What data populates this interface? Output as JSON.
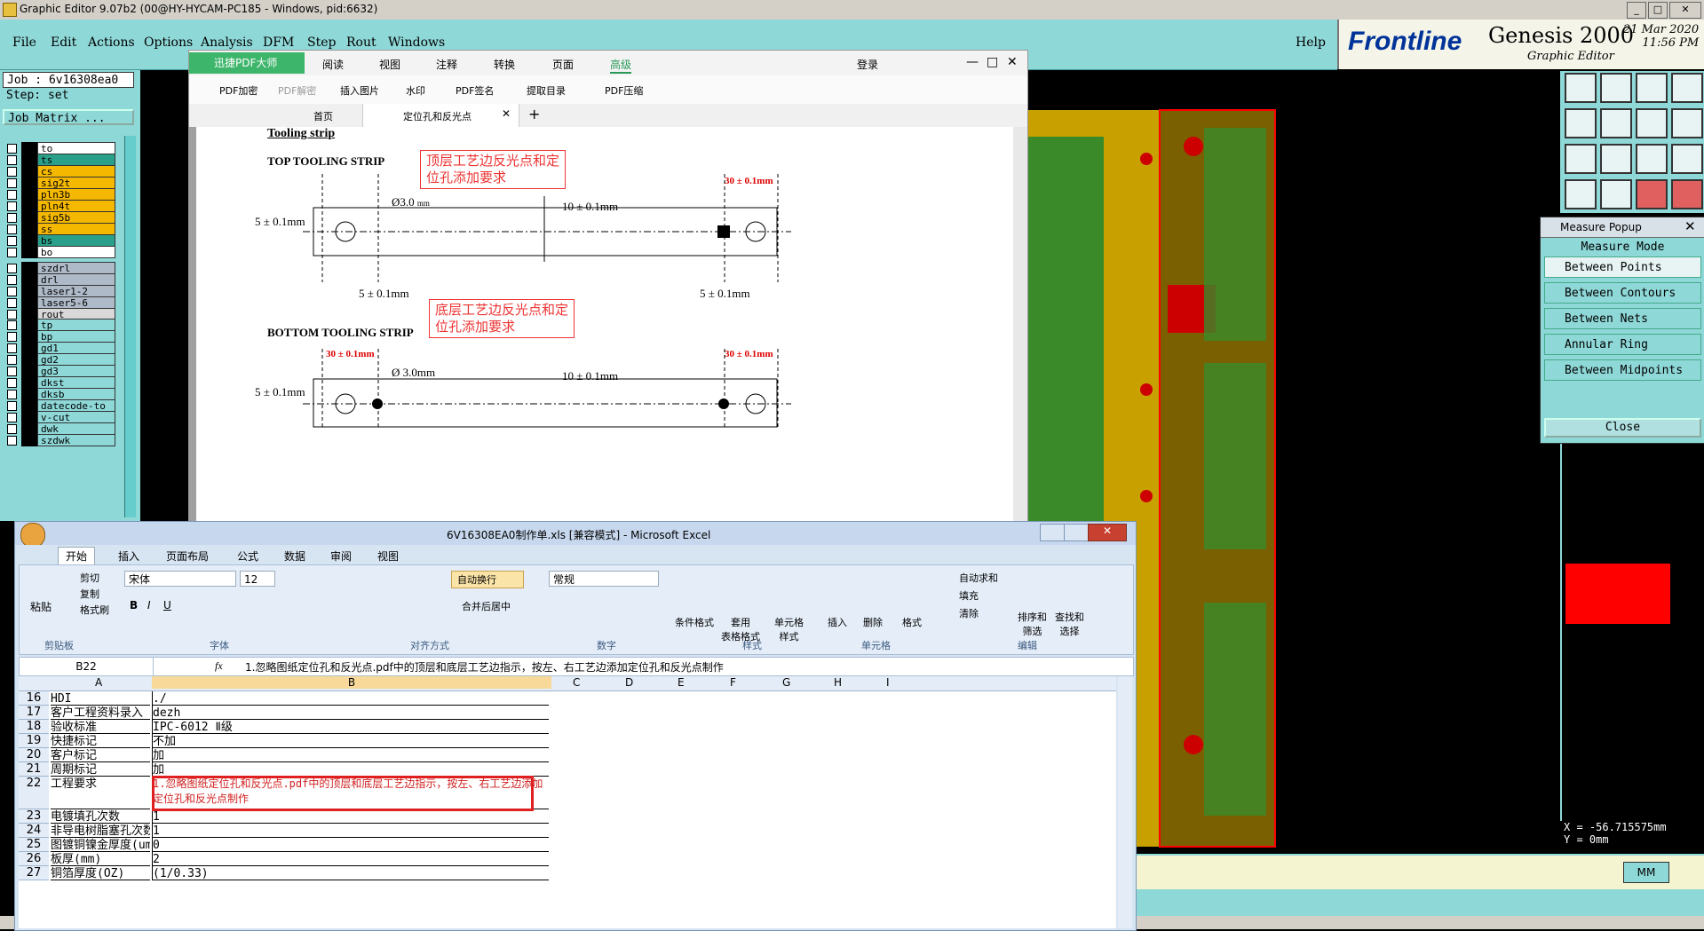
{
  "genesis": {
    "window_title": "Graphic Editor 9.07b2 (00@HY-HYCAM-PC185 - Windows, pid:6632)",
    "menu": [
      "File",
      "Edit",
      "Actions",
      "Options",
      "Analysis",
      "DFM",
      "Step",
      "Rout",
      "Windows"
    ],
    "help": "Help",
    "logo": "Frontline",
    "product": "Genesis 2000",
    "product_sub": "Graphic Editor",
    "date": "21 Mar 2020",
    "time": "11:56 PM",
    "job": "Job : 6v16308ea0",
    "step": "Step: set",
    "job_matrix": "Job Matrix ...",
    "layers_group1": [
      {
        "name": "to",
        "color": "#ffffff"
      },
      {
        "name": "ts",
        "color": "#2aa08a"
      },
      {
        "name": "cs",
        "color": "#f5b800"
      },
      {
        "name": "sig2t",
        "color": "#f5b800"
      },
      {
        "name": "pln3b",
        "color": "#f5b800"
      },
      {
        "name": "pln4t",
        "color": "#f5b800"
      },
      {
        "name": "sig5b",
        "color": "#f5b800"
      },
      {
        "name": "ss",
        "color": "#f5b800"
      },
      {
        "name": "bs",
        "color": "#2aa08a"
      },
      {
        "name": "bo",
        "color": "#ffffff"
      }
    ],
    "layers_group2": [
      {
        "name": "szdrl",
        "color": "#aebac8"
      },
      {
        "name": "drl",
        "color": "#aebac8"
      },
      {
        "name": "laser1-2",
        "color": "#aebac8"
      },
      {
        "name": "laser5-6",
        "color": "#aebac8"
      },
      {
        "name": "rout",
        "color": "#d8d8d8"
      }
    ],
    "layers_group3": [
      {
        "name": "tp"
      },
      {
        "name": "bp"
      },
      {
        "name": "gd1"
      },
      {
        "name": "gd2"
      },
      {
        "name": "gd3"
      },
      {
        "name": "dkst"
      },
      {
        "name": "dksb"
      },
      {
        "name": "datecode-to"
      },
      {
        "name": "v-cut"
      },
      {
        "name": "dwk"
      },
      {
        "name": "szdwk"
      }
    ],
    "coords": {
      "x": "X = -56.715575mm",
      "y": "Y = 0mm"
    },
    "units": "MM"
  },
  "measure_popup": {
    "title": "Measure Popup",
    "header": "Measure Mode",
    "options": [
      "Between Points",
      "Between Contours",
      "Between Nets",
      "Annular Ring",
      "Between Midpoints"
    ],
    "close": "Close"
  },
  "pdf": {
    "app_name": "迅捷PDF大师",
    "top_tabs": [
      "阅读",
      "视图",
      "注释",
      "转换",
      "页面",
      "高级"
    ],
    "login": "登录",
    "tools": [
      "PDF加密",
      "PDF解密",
      "插入图片",
      "水印",
      "PDF签名",
      "提取目录",
      "PDF压缩"
    ],
    "home_tab": "首页",
    "doc_tab": "定位孔和反光点",
    "content": {
      "heading": "Tooling strip",
      "top_title": "TOP TOOLING STRIP",
      "top_note": "顶层工艺边反光点和定位孔添加要求",
      "dia1": "Ø3.0",
      "dia1_unit": "mm",
      "dim_10": "10 ± 0.1mm",
      "dim_30": "30 ± 0.1mm",
      "dim_5": "5 ± 0.1mm",
      "bottom_title": "BOTTOM TOOLING STRIP",
      "bottom_note": "底层工艺边反光点和定位孔添加要求",
      "dia2": "Ø 3.0mm"
    }
  },
  "excel": {
    "title": "6V16308EA0制作单.xls [兼容模式] - Microsoft Excel",
    "tabs": [
      "开始",
      "插入",
      "页面布局",
      "公式",
      "数据",
      "审阅",
      "视图"
    ],
    "clipboard": {
      "paste": "粘贴",
      "cut": "剪切",
      "copy": "复制",
      "format_painter": "格式刷",
      "group": "剪贴板"
    },
    "font": {
      "name": "宋体",
      "size": "12",
      "group": "字体"
    },
    "align": {
      "wrap": "自动换行",
      "merge": "合并后居中",
      "group": "对齐方式"
    },
    "number": {
      "format": "常规",
      "group": "数字"
    },
    "styles": {
      "cond": "条件格式",
      "table": "套用\n表格格式",
      "cell": "单元格\n样式",
      "group": "样式"
    },
    "cells": {
      "insert": "插入",
      "delete": "删除",
      "format": "格式",
      "group": "单元格"
    },
    "editing": {
      "autosum": "自动求和",
      "fill": "填充",
      "clear": "清除",
      "sort": "排序和\n筛选",
      "find": "查找和\n选择",
      "group": "编辑"
    },
    "name_box": "B22",
    "formula": "1.忽略图纸定位孔和反光点.pdf中的顶层和底层工艺边指示，按左、右工艺边添加定位孔和反光点制作",
    "columns": [
      "A",
      "B",
      "C",
      "D",
      "E",
      "F",
      "G",
      "H",
      "I"
    ],
    "rows": [
      {
        "n": "16",
        "a": "HDI",
        "b": "./"
      },
      {
        "n": "17",
        "a": "客户工程资料录入",
        "b": "dezh"
      },
      {
        "n": "18",
        "a": "验收标准",
        "b": "IPC-6012 Ⅱ级"
      },
      {
        "n": "19",
        "a": "快捷标记",
        "b": "不加"
      },
      {
        "n": "20",
        "a": "客户标记",
        "b": "加"
      },
      {
        "n": "21",
        "a": "周期标记",
        "b": "加"
      },
      {
        "n": "22",
        "a": "工程要求",
        "b": "1.忽略图纸定位孔和反光点.pdf中的顶层和底层工艺边指示，按左、右工艺边添加定位孔和反光点制作"
      },
      {
        "n": "23",
        "a": "电镀填孔次数",
        "b": "1"
      },
      {
        "n": "24",
        "a": "非导电树脂塞孔次数",
        "b": "1"
      },
      {
        "n": "25",
        "a": "图镀铜镍金厚度(um)",
        "b": "0"
      },
      {
        "n": "26",
        "a": "板厚(mm)",
        "b": "2"
      },
      {
        "n": "27",
        "a": "铜箔厚度(OZ)",
        "b": "(1/0.33)"
      }
    ]
  }
}
